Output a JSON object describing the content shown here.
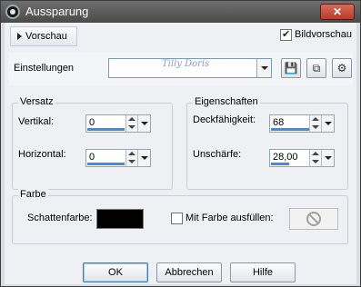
{
  "window": {
    "title": "Aussparung",
    "close_icon": "close-x-icon"
  },
  "preview": {
    "toggle_label": "Vorschau",
    "bildvorschau_label": "Bildvorschau",
    "bildvorschau_checked": true
  },
  "settings": {
    "label": "Einstellungen",
    "preset_value": "",
    "watermark_text": "Tilly Doris",
    "tools": [
      "save-icon",
      "cube-icon",
      "manage-presets-icon"
    ]
  },
  "versatz": {
    "title": "Versatz",
    "vertical_label": "Vertikal:",
    "vertical_value": "0",
    "horizontal_label": "Horizontal:",
    "horizontal_value": "0"
  },
  "eigenschaften": {
    "title": "Eigenschaften",
    "opacity_label": "Deckfähigkeit:",
    "opacity_value": "68",
    "blur_label": "Unschärfe:",
    "blur_value": "28,00"
  },
  "farbe": {
    "title": "Farbe",
    "shadow_color_label": "Schattenfarbe:",
    "shadow_color": "#000000",
    "fill_label": "Mit Farbe ausfüllen:",
    "fill_checked": false
  },
  "buttons": {
    "ok": "OK",
    "cancel": "Abbrechen",
    "help": "Hilfe"
  }
}
